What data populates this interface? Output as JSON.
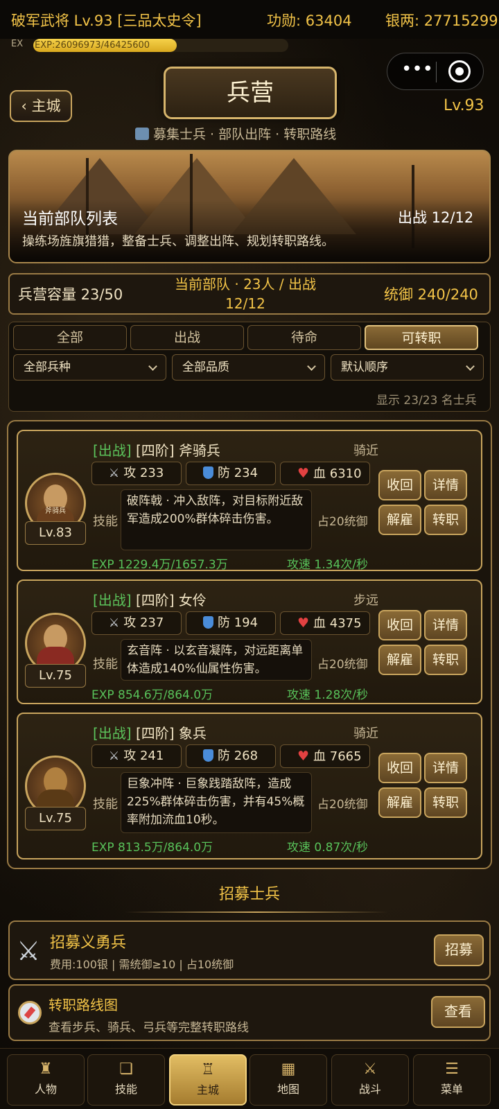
{
  "status": {
    "player": "破军武将 Lv.93 [三品太史令]",
    "merit": "功勋: 63404",
    "silver": "银两: 27715299",
    "exp_label": "EX",
    "exp_text": "EXP:26096973/46425600",
    "exp_progress": 0.562
  },
  "capsule": {
    "more_icon": "more-dots-icon",
    "close_icon": "target-icon"
  },
  "header": {
    "back_label": "主城",
    "back_arrow": "‹",
    "title": "兵营",
    "level": "Lv.93",
    "subtitle": "募集士兵 · 部队出阵 · 转职路线"
  },
  "banner": {
    "title": "当前部队列表",
    "deploy": "出战 12/12",
    "desc": "操练场旌旗猎猎，整备士兵、调整出阵、规划转职路线。"
  },
  "stats": {
    "capacity": "兵营容量 23/50",
    "current": "当前部队 · 23人 / 出战12/12",
    "command": "统御 240/240"
  },
  "filters": {
    "tabs": [
      "全部",
      "出战",
      "待命",
      "可转职"
    ],
    "active_tab": "可转职",
    "selects": [
      "全部兵种",
      "全部品质",
      "默认顺序"
    ],
    "showing": "显示 23/23 名士兵"
  },
  "units": [
    {
      "tag": "[出战]",
      "name": "[四阶] 斧骑兵",
      "type": "骑近",
      "atk": "攻 233",
      "def": "防 234",
      "hp": "血 6310",
      "skill_label": "技能",
      "skill": "破阵戟 · 冲入敌阵，对目标附近敌军造成200%群体碎击伤害。",
      "cost": "占20统御",
      "exp": "EXP 1229.4万/1657.3万",
      "speed": "攻速 1.34次/秒",
      "level": "Lv.83",
      "avatar_text": "斧骑兵",
      "buttons": [
        "收回",
        "详情",
        "解雇",
        "转职"
      ]
    },
    {
      "tag": "[出战]",
      "name": "[四阶] 女伶",
      "type": "步远",
      "atk": "攻 237",
      "def": "防 194",
      "hp": "血 4375",
      "skill_label": "技能",
      "skill": "玄音阵 · 以玄音凝阵，对远距离单体造成140%仙属性伤害。",
      "cost": "占20统御",
      "exp": "EXP 854.6万/864.0万",
      "speed": "攻速 1.28次/秒",
      "level": "Lv.75",
      "buttons": [
        "收回",
        "详情",
        "解雇",
        "转职"
      ]
    },
    {
      "tag": "[出战]",
      "name": "[四阶] 象兵",
      "type": "骑近",
      "atk": "攻 241",
      "def": "防 268",
      "hp": "血 7665",
      "skill_label": "技能",
      "skill": "巨象冲阵 · 巨象践踏敌阵，造成225%群体碎击伤害，并有45%概率附加流血10秒。",
      "cost": "占20统御",
      "exp": "EXP 813.5万/864.0万",
      "speed": "攻速 0.87次/秒",
      "level": "Lv.75",
      "buttons": [
        "收回",
        "详情",
        "解雇",
        "转职"
      ]
    }
  ],
  "recruit": {
    "heading": "招募士兵",
    "title": "招募义勇兵",
    "desc": "费用:100银 | 需统御≥10 | 占10统御",
    "button": "招募"
  },
  "route": {
    "title": "转职路线图",
    "desc": "查看步兵、骑兵、弓兵等完整转职路线",
    "button": "查看"
  },
  "nav": [
    {
      "label": "人物",
      "icon": "character-icon"
    },
    {
      "label": "技能",
      "icon": "scroll-icon"
    },
    {
      "label": "主城",
      "icon": "castle-icon",
      "active": true
    },
    {
      "label": "地图",
      "icon": "map-icon"
    },
    {
      "label": "战斗",
      "icon": "crossed-swords-icon"
    },
    {
      "label": "菜单",
      "icon": "menu-scroll-icon"
    }
  ],
  "colors": {
    "accent": "#f3c448",
    "border": "#c9a55e",
    "green": "#58c25a",
    "background": "#120e09"
  }
}
